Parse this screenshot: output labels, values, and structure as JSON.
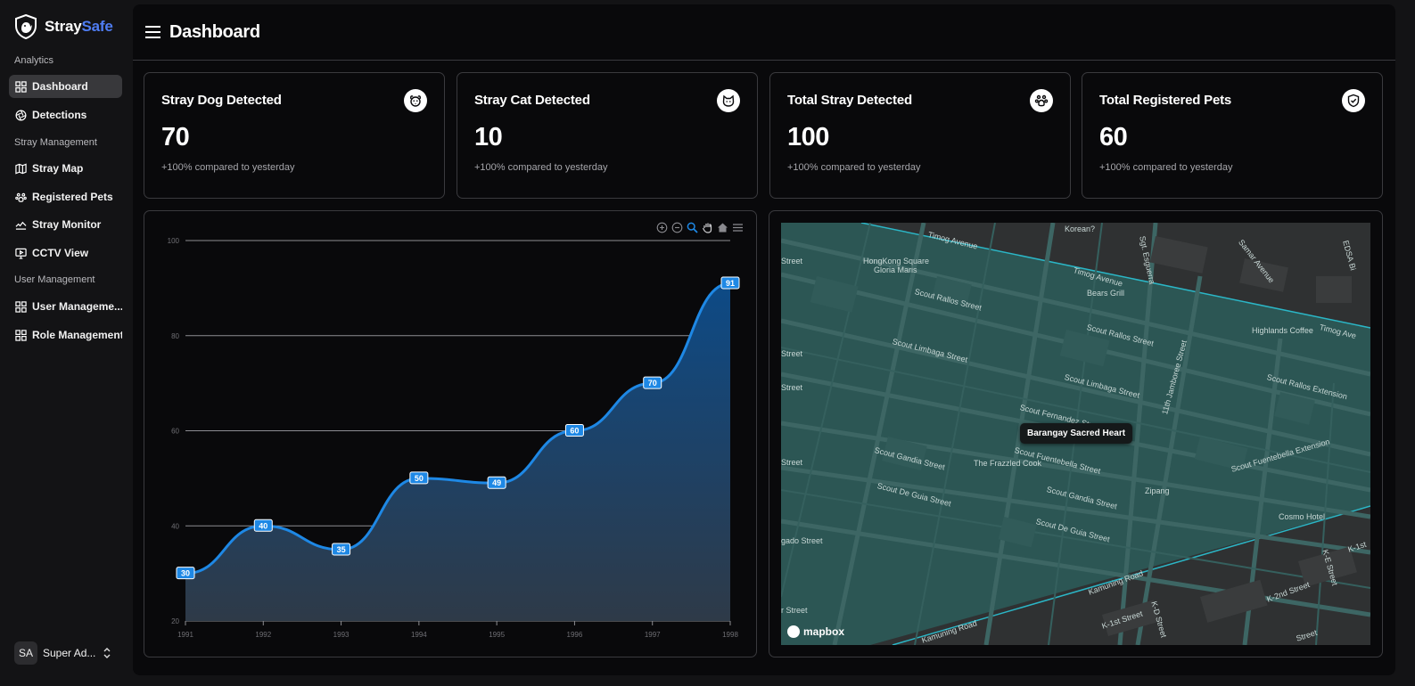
{
  "brand": {
    "part1": "Stray",
    "part2": "Safe"
  },
  "sidebar": {
    "sections": [
      {
        "label": "Analytics"
      },
      {
        "label": "Stray Management"
      },
      {
        "label": "User Management"
      }
    ],
    "items": [
      {
        "label": "Dashboard",
        "icon": "grid-icon",
        "active": true
      },
      {
        "label": "Detections",
        "icon": "aperture-icon"
      },
      {
        "label": "Stray Map",
        "icon": "map-icon"
      },
      {
        "label": "Registered Pets",
        "icon": "paw-icon"
      },
      {
        "label": "Stray Monitor",
        "icon": "monitor-icon"
      },
      {
        "label": "CCTV View",
        "icon": "screen-icon"
      },
      {
        "label": "User Manageme...",
        "icon": "grid-icon"
      },
      {
        "label": "Role Management",
        "icon": "grid-icon"
      }
    ],
    "user": {
      "initials": "SA",
      "name": "Super Ad..."
    }
  },
  "header": {
    "title": "Dashboard"
  },
  "cards": [
    {
      "title": "Stray Dog Detected",
      "value": "70",
      "sub": "+100% compared to yesterday",
      "icon": "dog-icon"
    },
    {
      "title": "Stray Cat Detected",
      "value": "10",
      "sub": "+100% compared to yesterday",
      "icon": "cat-icon"
    },
    {
      "title": "Total Stray Detected",
      "value": "100",
      "sub": "+100% compared to yesterday",
      "icon": "paw-icon"
    },
    {
      "title": "Total Registered Pets",
      "value": "60",
      "sub": "+100% compared to yesterday",
      "icon": "shield-icon"
    }
  ],
  "chart_data": {
    "type": "area",
    "x": [
      "1991",
      "1992",
      "1993",
      "1994",
      "1995",
      "1996",
      "1997",
      "1998"
    ],
    "values": [
      30,
      40,
      35,
      50,
      49,
      60,
      70,
      91
    ],
    "ylim": [
      20,
      100
    ],
    "yticks": [
      "100",
      "80",
      "60",
      "40",
      "20"
    ],
    "grid": true,
    "line_color": "#1e88e5"
  },
  "map": {
    "tooltip": "Barangay Sacred Heart",
    "logo": "mapbox",
    "labels": [
      "Timog Avenue",
      "Korean?",
      "Sgt. Esguerra",
      "Samar Avenue",
      "EDSA Bi",
      "HongKong Square",
      "Gloria Maris",
      "Timog Avenue",
      "Scout Rallos Street",
      "Bears Grill",
      "Scout Rallos Street",
      "Highlands Coffee",
      "Timog Ave",
      "Scout Limbaga Street",
      "11th Jamboree Street",
      "Scout Limbaga Street",
      "Scout Rallos Extension",
      "Scout Fernandez Street",
      "Scout Gandia Street",
      "Scout Fuentebella Street",
      "Scout Fuentebella Extension",
      "The Frazzled Cook",
      "Scout De Guia Street",
      "Scout Gandia Street",
      "Zipang",
      "Cosmo Hotel",
      "Scout De Guia Street",
      "Kamuning Road",
      "K-1st",
      "K-2nd Street",
      "K-E Street",
      "K-D Street",
      "K-1st Street",
      "Kamuning Road",
      "Street",
      "Street",
      "Street",
      "Street",
      "gado Street",
      "r Street",
      "Street"
    ]
  }
}
